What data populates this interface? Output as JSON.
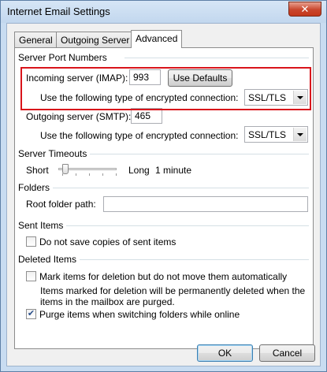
{
  "window": {
    "title": "Internet Email Settings",
    "close_glyph": "✕"
  },
  "tabs": [
    {
      "label": "General"
    },
    {
      "label": "Outgoing Server"
    },
    {
      "label": "Advanced"
    }
  ],
  "server_ports": {
    "heading": "Server Port Numbers",
    "incoming_label": "Incoming server (IMAP):",
    "incoming_value": "993",
    "use_defaults_label": "Use Defaults",
    "incoming_encryption_label": "Use the following type of encrypted connection:",
    "incoming_encryption_value": "SSL/TLS",
    "outgoing_label": "Outgoing server (SMTP):",
    "outgoing_value": "465",
    "outgoing_encryption_label": "Use the following type of encrypted connection:",
    "outgoing_encryption_value": "SSL/TLS"
  },
  "timeouts": {
    "heading": "Server Timeouts",
    "short_label": "Short",
    "long_label": "Long",
    "value_label": "1 minute",
    "slider_level": 0.05
  },
  "folders": {
    "heading": "Folders",
    "root_label": "Root folder path:",
    "root_value": ""
  },
  "sent_items": {
    "heading": "Sent Items",
    "no_save_label": "Do not save copies of sent items",
    "no_save_checked": false
  },
  "deleted_items": {
    "heading": "Deleted Items",
    "mark_label": "Mark items for deletion but do not move them automatically",
    "mark_checked": false,
    "note_line1": "Items marked for deletion will be permanently deleted when the",
    "note_line2": "items in the mailbox are purged.",
    "purge_label": "Purge items when switching folders while online",
    "purge_checked": true,
    "check_glyph": "✔"
  },
  "footer": {
    "ok_label": "OK",
    "cancel_label": "Cancel"
  }
}
